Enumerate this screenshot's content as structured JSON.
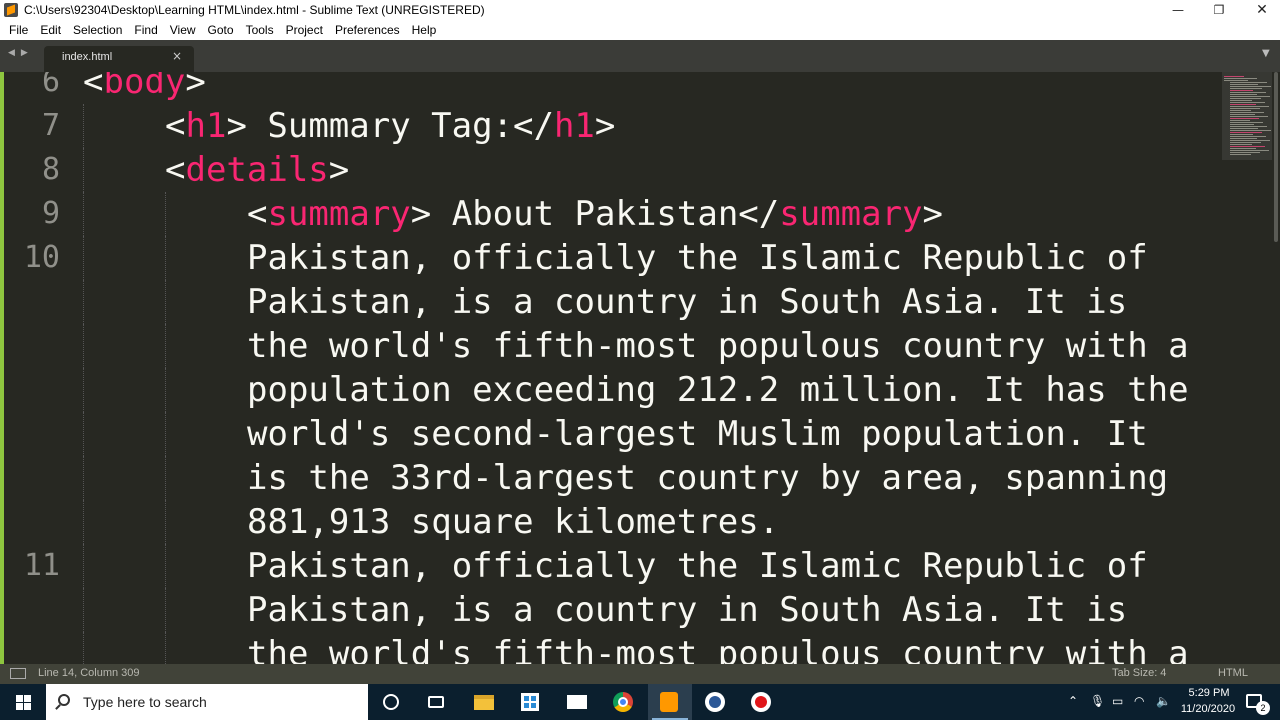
{
  "window": {
    "title": "C:\\Users\\92304\\Desktop\\Learning HTML\\index.html - Sublime Text (UNREGISTERED)",
    "controls": {
      "minimize": "—",
      "maximize": "❐",
      "close": "✕"
    }
  },
  "menu": [
    "File",
    "Edit",
    "Selection",
    "Find",
    "View",
    "Goto",
    "Tools",
    "Project",
    "Preferences",
    "Help"
  ],
  "tabs": {
    "nav_left": "◀",
    "nav_right": "▶",
    "active_label": "index.html",
    "close": "×",
    "dropdown": "▼"
  },
  "editor": {
    "lines": [
      {
        "number": "6",
        "segments": [
          [
            "p",
            "<"
          ],
          [
            "t",
            "body"
          ],
          [
            "p",
            ">"
          ]
        ]
      },
      {
        "number": "7",
        "segments": [
          [
            "p",
            "<"
          ],
          [
            "t",
            "h1"
          ],
          [
            "p",
            "> Summary Tag:</"
          ],
          [
            "t",
            "h1"
          ],
          [
            "p",
            ">"
          ]
        ]
      },
      {
        "number": "8",
        "segments": [
          [
            "p",
            "<"
          ],
          [
            "t",
            "details"
          ],
          [
            "p",
            ">"
          ]
        ]
      },
      {
        "number": "9",
        "segments": [
          [
            "p",
            "<"
          ],
          [
            "t",
            "summary"
          ],
          [
            "p",
            "> About Pakistan</"
          ],
          [
            "t",
            "summary"
          ],
          [
            "p",
            ">"
          ]
        ]
      },
      {
        "number": "10",
        "segments": [
          [
            "p",
            "Pakistan, officially the Islamic Republic of"
          ]
        ]
      },
      {
        "number": "",
        "segments": [
          [
            "p",
            "Pakistan, is a country in South Asia. It is"
          ]
        ]
      },
      {
        "number": "",
        "segments": [
          [
            "p",
            "the world's fifth-most populous country with a"
          ]
        ]
      },
      {
        "number": "",
        "segments": [
          [
            "p",
            "population exceeding 212.2 million. It has the"
          ]
        ]
      },
      {
        "number": "",
        "segments": [
          [
            "p",
            "world's second-largest Muslim population. It"
          ]
        ]
      },
      {
        "number": "",
        "segments": [
          [
            "p",
            "is the 33rd-largest country by area, spanning"
          ]
        ]
      },
      {
        "number": "",
        "segments": [
          [
            "p",
            "881,913 square kilometres."
          ]
        ]
      },
      {
        "number": "11",
        "segments": [
          [
            "p",
            "Pakistan, officially the Islamic Republic of"
          ]
        ]
      },
      {
        "number": "",
        "segments": [
          [
            "p",
            "Pakistan, is a country in South Asia. It is"
          ]
        ]
      },
      {
        "number": "",
        "segments": [
          [
            "p",
            "the world's fifth-most populous country with a"
          ]
        ]
      }
    ],
    "indent_levels": [
      1,
      2,
      2,
      3,
      3,
      3,
      3,
      3,
      3,
      3,
      3,
      3,
      3,
      3
    ]
  },
  "status": {
    "position": "Line 14, Column 309",
    "tab_size": "Tab Size: 4",
    "syntax": "HTML"
  },
  "taskbar": {
    "search_placeholder": "Type here to search",
    "clock_time": "5:29 PM",
    "clock_date": "11/20/2020",
    "notification_count": "2",
    "tray_icons": [
      "chevron-up-icon",
      "microphone-icon",
      "battery-icon",
      "wifi-icon",
      "speaker-icon"
    ]
  }
}
